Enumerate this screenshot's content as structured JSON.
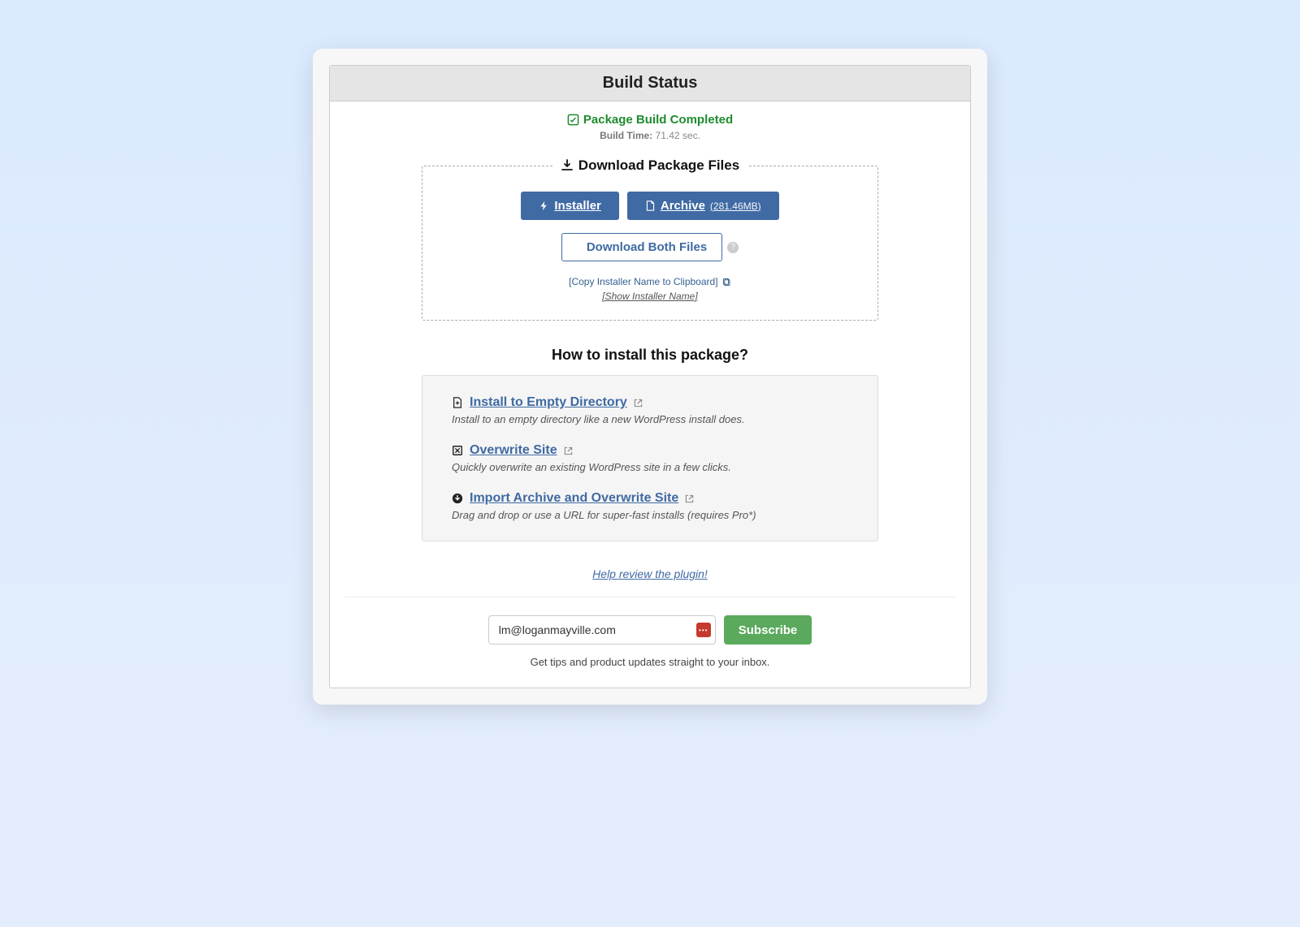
{
  "header": {
    "title": "Build Status"
  },
  "status": {
    "message": "Package Build Completed",
    "build_time_label": "Build Time:",
    "build_time_value": "71.42 sec."
  },
  "download": {
    "legend": "Download Package Files",
    "installer_label": "Installer",
    "archive_label": "Archive",
    "archive_size": "(281.46MB)",
    "both_label": "Download Both Files",
    "copy_link": "[Copy Installer Name to Clipboard]",
    "show_link": "[Show Installer Name]"
  },
  "howto": {
    "title": "How to install this package?",
    "items": [
      {
        "title": "Install to Empty Directory",
        "desc": "Install to an empty directory like a new WordPress install does."
      },
      {
        "title": "Overwrite Site",
        "desc": "Quickly overwrite an existing WordPress site in a few clicks."
      },
      {
        "title": "Import Archive and Overwrite Site",
        "desc": "Drag and drop or use a URL for super-fast installs (requires Pro*)"
      }
    ]
  },
  "review": {
    "link": "Help review the plugin!"
  },
  "subscribe": {
    "email": "lm@loganmayville.com",
    "button": "Subscribe",
    "tip": "Get tips and product updates straight to your inbox."
  }
}
